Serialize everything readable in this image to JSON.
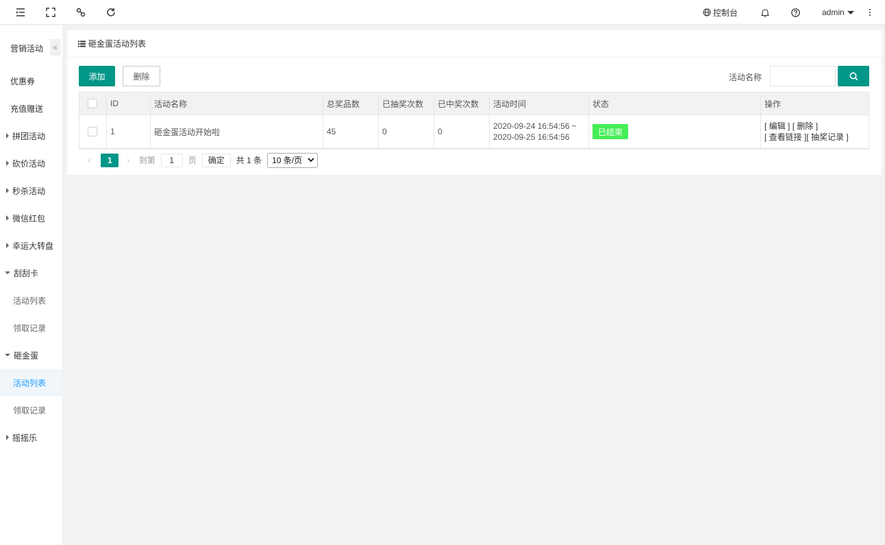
{
  "topbar": {
    "icons": [
      "indent-icon",
      "fullscreen-icon",
      "link-icon",
      "refresh-icon"
    ],
    "console_label": "控制台",
    "user_name": "admin"
  },
  "sidebar": {
    "title": "营销活动",
    "collapse_glyph": "«",
    "items": [
      {
        "label": "优惠券"
      },
      {
        "label": "充值赠送"
      },
      {
        "label": "拼团活动"
      },
      {
        "label": "砍价活动"
      },
      {
        "label": "秒杀活动"
      },
      {
        "label": "微信红包"
      },
      {
        "label": "幸运大转盘"
      },
      {
        "label": "刮刮卡"
      },
      {
        "label": "活动列表"
      },
      {
        "label": "领取记录"
      },
      {
        "label": "砸金蛋"
      },
      {
        "label": "活动列表"
      },
      {
        "label": "领取记录"
      },
      {
        "label": "摇摇乐"
      }
    ]
  },
  "card": {
    "title": "砸金蛋活动列表"
  },
  "toolbar": {
    "add_label": "添加",
    "delete_label": "删除",
    "search_label": "活动名称",
    "search_value": ""
  },
  "table": {
    "headers": [
      "ID",
      "活动名称",
      "总奖品数",
      "已抽奖次数",
      "已中奖次数",
      "活动时间",
      "状态",
      "操作"
    ],
    "rows": [
      {
        "id": "1",
        "name": "砸金蛋活动开始啦",
        "total_prizes": "45",
        "draw_count": "0",
        "win_count": "0",
        "time_start": "2020-09-24 16:54:56 ~",
        "time_end": "2020-09-25 16:54:56",
        "status": "已结束",
        "op_edit": "[ 编辑 ]",
        "op_delete": "[ 删除 ]",
        "op_link": "[ 查看链接 ]",
        "op_records": "[ 抽奖记录 ]"
      }
    ]
  },
  "pager": {
    "current": "1",
    "goto_label": "到第",
    "goto_value": "1",
    "page_unit": "页",
    "confirm": "确定",
    "total": "共 1 条",
    "page_size": "10 条/页"
  },
  "colors": {
    "primary": "#009688",
    "status_ended": "#44ee55",
    "active_menu": "#1e9fff"
  }
}
